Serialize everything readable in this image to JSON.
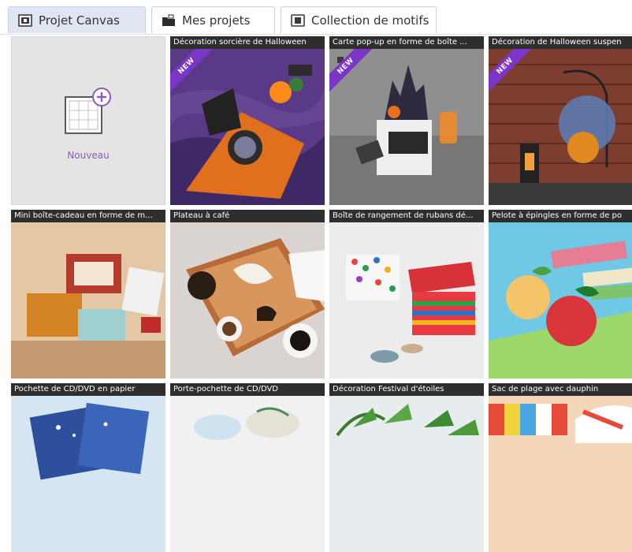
{
  "tabs": [
    {
      "label": "Projet Canvas",
      "icon": "canvas-project-icon",
      "active": true
    },
    {
      "label": "Mes projets",
      "icon": "folder-icon",
      "active": false
    },
    {
      "label": "Collection de motifs",
      "icon": "pattern-collection-icon",
      "active": false
    }
  ],
  "new_project": {
    "label": "Nouveau",
    "icon": "new-project-icon"
  },
  "badge_label": "NEW",
  "colors": {
    "active_tab": "#dfe6f2",
    "title_bar": "#2e2e2e",
    "new_label": "#8e59b8",
    "new_badge": "#7b35c9"
  },
  "projects": [
    {
      "title": "Décoration sorcière de Halloween",
      "is_new": true
    },
    {
      "title": "Carte pop-up en forme de boîte ...",
      "is_new": true
    },
    {
      "title": "Décoration de Halloween suspen",
      "is_new": true
    },
    {
      "title": "Mini boîte-cadeau en forme de m...",
      "is_new": false
    },
    {
      "title": "Plateau à café",
      "is_new": false
    },
    {
      "title": "Boîte de rangement de rubans dé...",
      "is_new": false
    },
    {
      "title": "Pelote à épingles en forme de po",
      "is_new": false
    },
    {
      "title": "Pochette de CD/DVD en papier",
      "is_new": false
    },
    {
      "title": "Porte-pochette de CD/DVD",
      "is_new": false
    },
    {
      "title": "Décoration Festival d'étoiles",
      "is_new": false
    },
    {
      "title": "Sac de plage avec dauphin",
      "is_new": false
    }
  ]
}
